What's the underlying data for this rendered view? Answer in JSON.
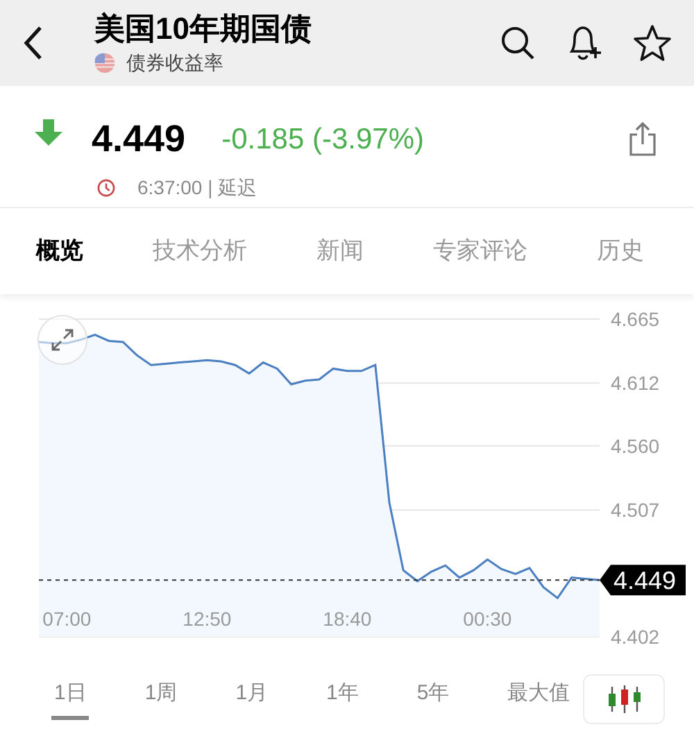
{
  "header": {
    "title": "美国10年期国债",
    "subtitle": "债券收益率"
  },
  "quote": {
    "kind": "down",
    "price": "4.449",
    "change": "-0.185 (-3.97%)",
    "time": "6:37:00 | 延迟"
  },
  "tabs": [
    {
      "label": "概览",
      "selected": true
    },
    {
      "label": "技术分析",
      "selected": false
    },
    {
      "label": "新闻",
      "selected": false
    },
    {
      "label": "专家评论",
      "selected": false
    },
    {
      "label": "历史",
      "selected": false
    }
  ],
  "chart": {
    "chart_data": {
      "type": "area",
      "grid": true,
      "ref_lines": [
        {
          "axis": "y",
          "value": 4.449,
          "label": "4.449"
        }
      ],
      "categories": [
        null,
        null,
        "07:00",
        null,
        null,
        null,
        null,
        null,
        null,
        null,
        null,
        null,
        "12:50",
        null,
        null,
        null,
        null,
        null,
        null,
        null,
        null,
        null,
        "18:40",
        null,
        null,
        null,
        null,
        null,
        null,
        null,
        null,
        null,
        "00:30",
        null,
        null,
        null,
        null,
        null,
        null,
        null,
        null
      ],
      "series": [
        {
          "color": "#4a7fc1",
          "values": [
            4.646,
            4.645,
            4.645,
            4.648,
            4.652,
            4.647,
            4.646,
            4.635,
            4.627,
            4.628,
            4.629,
            4.63,
            4.631,
            4.63,
            4.627,
            4.62,
            4.629,
            4.624,
            4.611,
            4.614,
            4.615,
            4.624,
            4.622,
            4.622,
            4.627,
            4.513,
            4.457,
            4.448,
            4.456,
            4.461,
            4.451,
            4.457,
            4.466,
            4.458,
            4.454,
            4.459,
            4.443,
            4.434,
            4.451,
            4.45,
            4.449
          ]
        }
      ],
      "ylim": [
        4.402,
        4.665
      ],
      "yticks": [
        {
          "value": 4.665,
          "label": "4.665"
        },
        {
          "value": 4.612,
          "label": "4.612"
        },
        {
          "value": 4.56,
          "label": "4.560"
        },
        {
          "value": 4.507,
          "label": "4.507"
        },
        {
          "value": 4.402,
          "label": "4.402"
        }
      ]
    }
  },
  "ranges": [
    {
      "label": "1日",
      "selected": true
    },
    {
      "label": "1周",
      "selected": false
    },
    {
      "label": "1月",
      "selected": false
    },
    {
      "label": "1年",
      "selected": false
    },
    {
      "label": "5年",
      "selected": false
    },
    {
      "label": "最大值",
      "selected": false
    }
  ]
}
